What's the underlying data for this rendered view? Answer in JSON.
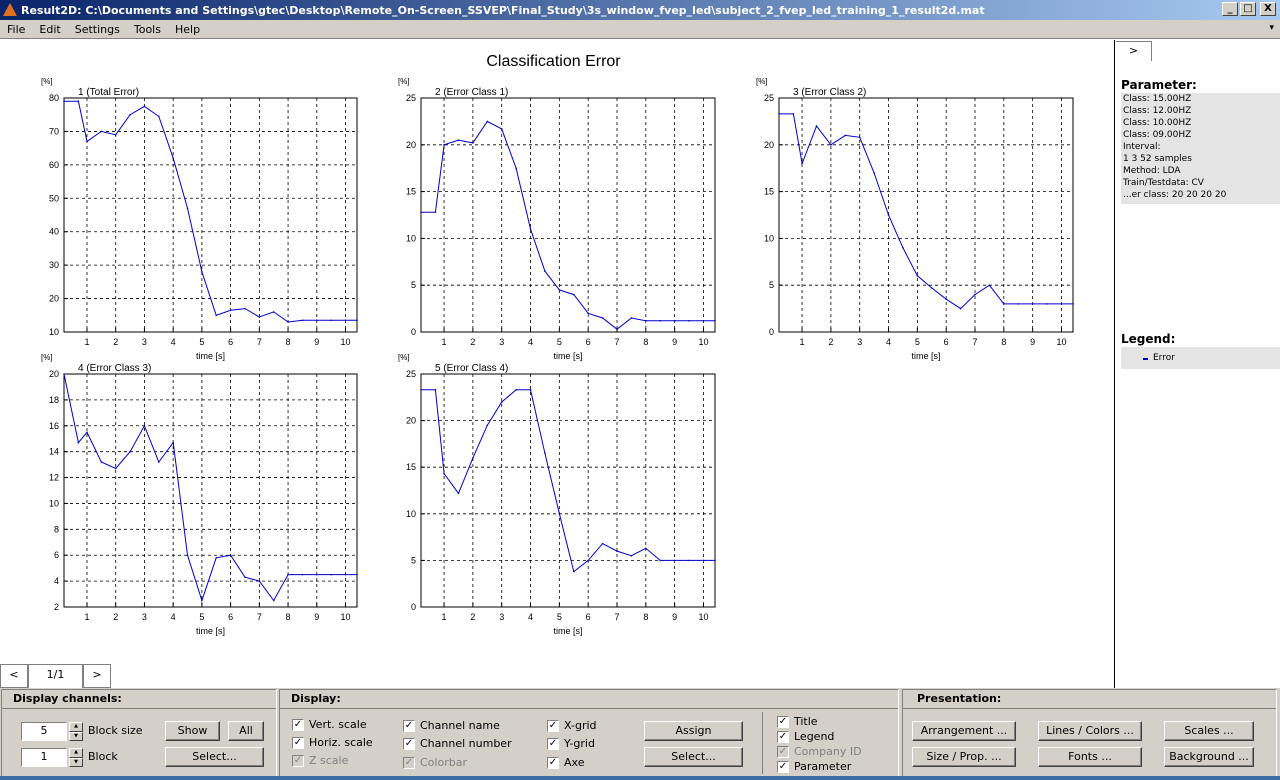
{
  "window": {
    "title": "Result2D:  C:\\Documents and Settings\\gtec\\Desktop\\Remote_On-Screen_SSVEP\\Final_Study\\3s_window_fvep_led\\subject_2_fvep_led_training_1_result2d.mat",
    "minimize": "_",
    "maximize": "□",
    "close": "X"
  },
  "menu": {
    "items": [
      "File",
      "Edit",
      "Settings",
      "Tools",
      "Help"
    ],
    "corner": "▾"
  },
  "figure": {
    "title": "Classification Error"
  },
  "chart_data": [
    {
      "type": "line",
      "title": "1 (Total Error)",
      "xlabel": "time [s]",
      "ylabel": "[%]",
      "ylim": [
        10,
        80
      ],
      "xlim": [
        0.2,
        10.4
      ],
      "yticks": [
        10,
        20,
        30,
        40,
        50,
        60,
        70,
        80
      ],
      "xticks": [
        1,
        2,
        3,
        4,
        5,
        6,
        7,
        8,
        9,
        10
      ],
      "grid": true,
      "series": [
        {
          "name": "Error",
          "x": [
            0.2,
            0.7,
            1.0,
            1.5,
            2.0,
            2.5,
            3.0,
            3.5,
            4.0,
            4.5,
            5.0,
            5.5,
            6.0,
            6.5,
            7.0,
            7.5,
            8.0,
            8.5,
            9.0,
            9.5,
            10.0,
            10.4
          ],
          "y": [
            79,
            79,
            67,
            70,
            69,
            75,
            77.5,
            74.5,
            62,
            47,
            28,
            15,
            16.5,
            17,
            14.5,
            16,
            13,
            13.5,
            13.5,
            13.5,
            13.5,
            13.5
          ]
        }
      ]
    },
    {
      "type": "line",
      "title": "2 (Error Class 1)",
      "xlabel": "time [s]",
      "ylabel": "[%]",
      "ylim": [
        0,
        25
      ],
      "xlim": [
        0.2,
        10.4
      ],
      "yticks": [
        0,
        5,
        10,
        15,
        20,
        25
      ],
      "xticks": [
        1,
        2,
        3,
        4,
        5,
        6,
        7,
        8,
        9,
        10
      ],
      "grid": true,
      "series": [
        {
          "name": "Error",
          "x": [
            0.2,
            0.7,
            1.0,
            1.5,
            2.0,
            2.5,
            3.0,
            3.5,
            4.0,
            4.5,
            5.0,
            5.5,
            6.0,
            6.5,
            7.0,
            7.5,
            8.0,
            8.5,
            9.0,
            9.5,
            10.0,
            10.4
          ],
          "y": [
            12.8,
            12.8,
            20,
            20.5,
            20.2,
            22.5,
            21.7,
            17.5,
            11,
            6.5,
            4.5,
            4,
            2,
            1.5,
            0.3,
            1.5,
            1.2,
            1.2,
            1.2,
            1.2,
            1.2,
            1.2
          ]
        }
      ]
    },
    {
      "type": "line",
      "title": "3 (Error Class 2)",
      "xlabel": "time [s]",
      "ylabel": "[%]",
      "ylim": [
        0,
        25
      ],
      "xlim": [
        0.2,
        10.4
      ],
      "yticks": [
        0,
        5,
        10,
        15,
        20,
        25
      ],
      "xticks": [
        1,
        2,
        3,
        4,
        5,
        6,
        7,
        8,
        9,
        10
      ],
      "grid": true,
      "series": [
        {
          "name": "Error",
          "x": [
            0.2,
            0.7,
            1.0,
            1.5,
            2.0,
            2.5,
            3.0,
            3.5,
            4.0,
            4.5,
            5.0,
            5.5,
            6.0,
            6.5,
            7.0,
            7.5,
            8.0,
            8.5,
            9.0,
            9.5,
            10.0,
            10.4
          ],
          "y": [
            23.3,
            23.3,
            18,
            22,
            20,
            21,
            20.8,
            17,
            12.5,
            9,
            6,
            4.7,
            3.5,
            2.5,
            4,
            5,
            3,
            3,
            3,
            3,
            3,
            3
          ]
        }
      ]
    },
    {
      "type": "line",
      "title": "4 (Error Class 3)",
      "xlabel": "time [s]",
      "ylabel": "[%]",
      "ylim": [
        2,
        20
      ],
      "xlim": [
        0.2,
        10.4
      ],
      "yticks": [
        2,
        4,
        6,
        8,
        10,
        12,
        14,
        16,
        18,
        20
      ],
      "xticks": [
        1,
        2,
        3,
        4,
        5,
        6,
        7,
        8,
        9,
        10
      ],
      "grid": true,
      "series": [
        {
          "name": "Error",
          "x": [
            0.2,
            0.7,
            1.0,
            1.5,
            2.0,
            2.5,
            3.0,
            3.5,
            4.0,
            4.5,
            5.0,
            5.5,
            6.0,
            6.5,
            7.0,
            7.5,
            8.0,
            8.5,
            9.0,
            9.5,
            10.0,
            10.4
          ],
          "y": [
            20,
            14.7,
            15.5,
            13.2,
            12.7,
            14,
            16,
            13.2,
            14.7,
            6,
            2.5,
            5.8,
            6,
            4.3,
            4,
            2.5,
            4.5,
            4.5,
            4.5,
            4.5,
            4.5,
            4.5
          ]
        }
      ]
    },
    {
      "type": "line",
      "title": "5 (Error Class 4)",
      "xlabel": "time [s]",
      "ylabel": "[%]",
      "ylim": [
        0,
        25
      ],
      "xlim": [
        0.2,
        10.4
      ],
      "yticks": [
        0,
        5,
        10,
        15,
        20,
        25
      ],
      "xticks": [
        1,
        2,
        3,
        4,
        5,
        6,
        7,
        8,
        9,
        10
      ],
      "grid": true,
      "series": [
        {
          "name": "Error",
          "x": [
            0.2,
            0.7,
            1.0,
            1.5,
            2.0,
            2.5,
            3.0,
            3.5,
            4.0,
            4.5,
            5.0,
            5.5,
            6.0,
            6.5,
            7.0,
            7.5,
            8.0,
            8.5,
            9.0,
            9.5,
            10.0,
            10.4
          ],
          "y": [
            23.3,
            23.3,
            14.3,
            12.2,
            16,
            19.5,
            22,
            23.3,
            23.3,
            16.5,
            10,
            3.8,
            5,
            6.8,
            6,
            5.5,
            6.3,
            5,
            5,
            5,
            5,
            5
          ]
        }
      ]
    }
  ],
  "side_panel": {
    "toggle": ">",
    "parameter_title": "Parameter:",
    "parameters": [
      "Class: 15.00HZ",
      "Class: 12.00HZ",
      "Class: 10.00HZ",
      "Class: 09.00HZ",
      "Interval:",
      "1    3   52 samples",
      "Method: LDA",
      "Train/Testdata: CV",
      "...er class: 20   20   20   20"
    ],
    "legend_title": "Legend:",
    "legend_item": "Error",
    "line_color": "#0000cc"
  },
  "pager": {
    "prev": "<",
    "page": "1/1",
    "next": ">"
  },
  "display_channels": {
    "title": "Display channels:",
    "block_size_value": "5",
    "block_size_label": "Block size",
    "block_value": "1",
    "block_label": "Block",
    "show_button": "Show",
    "all_button": "All",
    "select_button": "Select..."
  },
  "display": {
    "title": "Display:",
    "vert_scale": {
      "label": "Vert. scale",
      "checked": "✓"
    },
    "horiz_scale": {
      "label": "Horiz. scale",
      "checked": "✓"
    },
    "z_scale": {
      "label": "Z scale",
      "checked": "✓"
    },
    "channel_name": {
      "label": "Channel name",
      "checked": "✓"
    },
    "channel_number": {
      "label": "Channel number",
      "checked": "✓"
    },
    "colorbar": {
      "label": "Colorbar",
      "checked": "✓"
    },
    "x_grid": {
      "label": "X-grid",
      "checked": "✓"
    },
    "y_grid": {
      "label": "Y-grid",
      "checked": "✓"
    },
    "axe": {
      "label": "Axe",
      "checked": "✓"
    },
    "assign_button": "Assign",
    "select_button": "Select...",
    "title_cb": {
      "label": "Title",
      "checked": "✓"
    },
    "legend_cb": {
      "label": "Legend",
      "checked": "✓"
    },
    "company_id_cb": {
      "label": "Company ID",
      "checked": "✓"
    },
    "parameter_cb": {
      "label": "Parameter",
      "checked": "✓"
    }
  },
  "presentation": {
    "title": "Presentation:",
    "arrangement_button": "Arrangement ...",
    "lines_colors_button": "Lines / Colors ...",
    "scales_button": "Scales ...",
    "size_prop_button": "Size / Prop. ...",
    "fonts_button": "Fonts ...",
    "background_button": "Background ..."
  },
  "spin": {
    "up": "▲",
    "down": "▼"
  }
}
